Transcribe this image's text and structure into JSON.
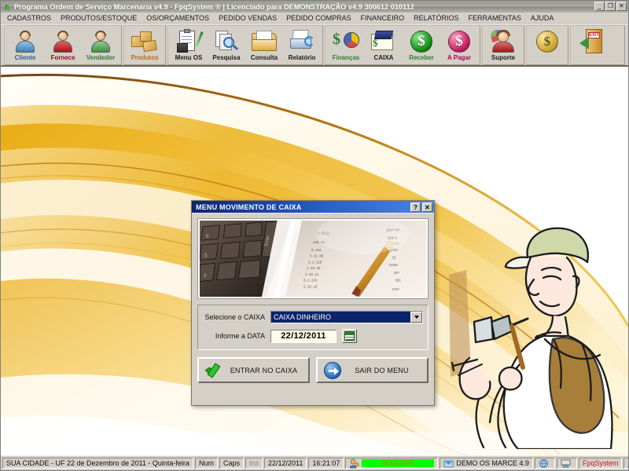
{
  "window": {
    "title": "Programa Ordem de Serviço Marcenaria v4.9 - FpqSystem ® | Licenciado para  DEMONSTRAÇÃO v4.9 300612 010112",
    "icon": "leaf-icon",
    "controls": {
      "minimize": "_",
      "restore": "❐",
      "close": "✕"
    }
  },
  "menubar": {
    "items": [
      {
        "label": "CADASTROS"
      },
      {
        "label": "PRODUTOS/ESTOQUE"
      },
      {
        "label": "OS/ORÇAMENTOS"
      },
      {
        "label": "PEDIDO VENDAS"
      },
      {
        "label": "PEDIDO COMPRAS"
      },
      {
        "label": "FINANCEIRO"
      },
      {
        "label": "RELATÓRIOS"
      },
      {
        "label": "FERRAMENTAS"
      },
      {
        "label": "AJUDA"
      }
    ]
  },
  "toolbar": {
    "groups": [
      {
        "buttons": [
          {
            "label": "Cliente",
            "icon": "person-blue-icon",
            "color": "#2a5fa8"
          },
          {
            "label": "Fornece",
            "icon": "person-red-icon",
            "color": "#8d1010"
          },
          {
            "label": "Vendedor",
            "icon": "person-green-icon",
            "color": "#2e7d32"
          }
        ]
      },
      {
        "buttons": [
          {
            "label": "Produtos",
            "icon": "boxes-icon",
            "color": "#b86a10"
          }
        ]
      },
      {
        "buttons": [
          {
            "label": "Menu OS",
            "icon": "clipboard-icon",
            "color": "#1a1a1a"
          },
          {
            "label": "Pesquisa",
            "icon": "search-pages-icon",
            "color": "#1a1a1a"
          },
          {
            "label": "Consulta",
            "icon": "folder-open-icon",
            "color": "#1a1a1a"
          },
          {
            "label": "Relatório",
            "icon": "printer-icon",
            "color": "#1a1a1a"
          }
        ]
      },
      {
        "buttons": [
          {
            "label": "Finanças",
            "icon": "pie-chart-dollar-icon",
            "color": "#2e7d32"
          },
          {
            "label": "CAIXA",
            "icon": "ledger-book-icon",
            "color": "#1a1a1a"
          },
          {
            "label": "Receber",
            "icon": "green-dollar-coin-icon",
            "color": "#2e7d32"
          },
          {
            "label": "A Pagar",
            "icon": "pink-dollar-coin-icon",
            "color": "#b4004e"
          }
        ]
      },
      {
        "buttons": [
          {
            "label": "Suporte",
            "icon": "support-agent-icon",
            "color": "#1a1a1a"
          }
        ]
      },
      {
        "buttons": [
          {
            "label": "",
            "icon": "gold-dollar-coin-icon",
            "color": "#1a1a1a"
          }
        ]
      },
      {
        "buttons": [
          {
            "label": "",
            "icon": "exit-door-icon",
            "color": "#1a1a1a"
          }
        ]
      }
    ]
  },
  "dialog": {
    "title": "MENU MOVIMENTO DE CAIXA",
    "help_button": "?",
    "close_button": "✕",
    "banner_alt": "keyboard-and-report-photo",
    "fields": {
      "caixa_label": "Selecione o CAIXA",
      "caixa_value": "CAIXA DINHEIRO",
      "caixa_options": [
        "CAIXA DINHEIRO"
      ],
      "data_label": "Informe a DATA",
      "data_value": "22/12/2011",
      "calendar_icon": "calendar-icon"
    },
    "buttons": {
      "confirm": "ENTRAR NO CAIXA",
      "confirm_icon": "green-check-icon",
      "cancel": "SAIR DO MENU",
      "cancel_icon": "blue-arrow-circle-icon"
    }
  },
  "desktop": {
    "wallpaper": "golden-swoosh-wallpaper",
    "mascot": "carpenter-with-hammer-illustration",
    "accent_color": "#e8a617"
  },
  "statusbar": {
    "location_date": "SUA CIDADE - UF 22 de Dezembro de 2011 - Quinta-feira",
    "num": "Num",
    "caps": "Caps",
    "ins": "Ins",
    "date": "22/12/2011",
    "time": "16:21:07",
    "user": "MASTER",
    "user_icon": "user-key-icon",
    "company": "DEMO OS MARCE 4.9",
    "company_icon": "company-icon",
    "icon_1": "globe-icon",
    "icon_2": "network-icon",
    "brand": "FpqSystem",
    "brand_icon": "user-key-icon-2"
  }
}
